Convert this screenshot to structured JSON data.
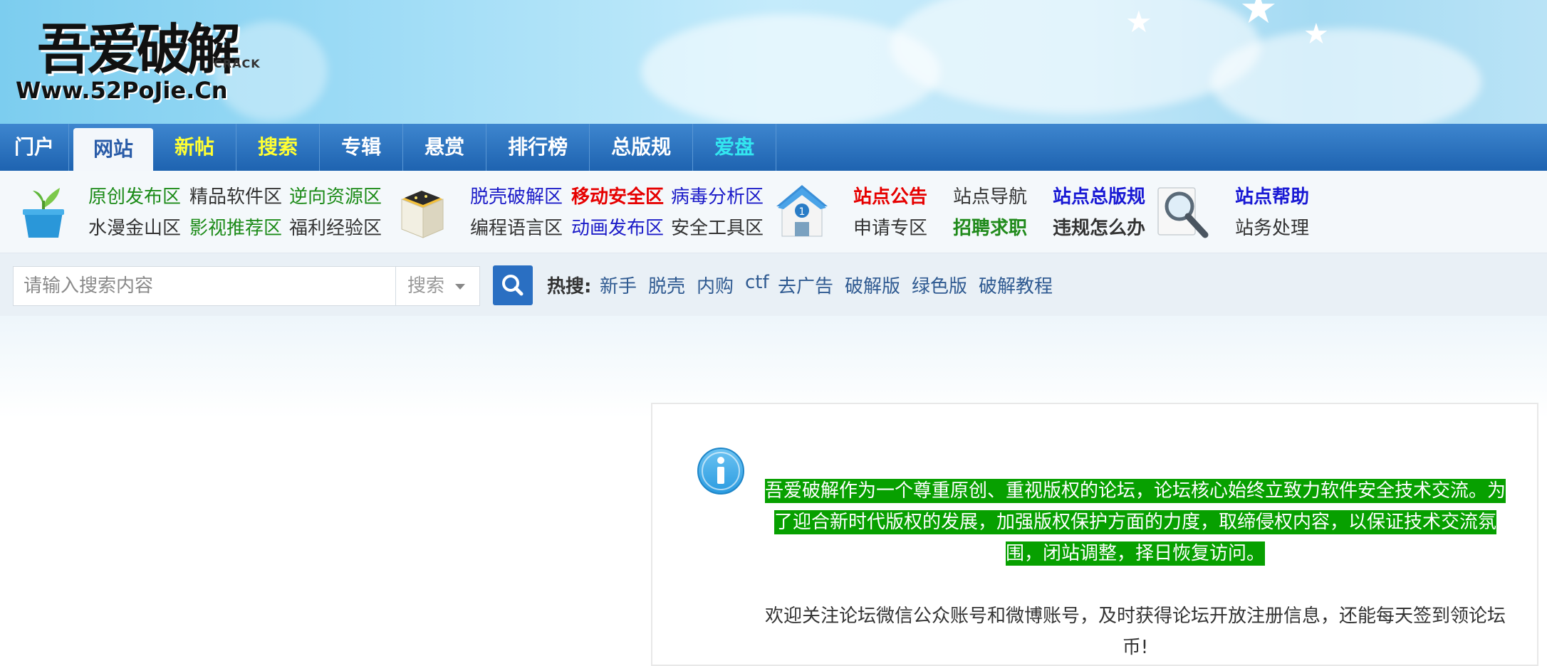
{
  "header": {
    "logo_cn": "吾爱破解",
    "logo_crack": "CRACK",
    "logo_url": "Www.52PoJie.Cn"
  },
  "nav": {
    "items": [
      {
        "label": "门户",
        "color": "#ffffff"
      },
      {
        "label": "网站",
        "color": "#2a5ca8",
        "active": true
      },
      {
        "label": "新帖",
        "color": "#ffff33"
      },
      {
        "label": "搜索",
        "color": "#ffff33"
      },
      {
        "label": "专辑",
        "color": "#ffffff"
      },
      {
        "label": "悬赏",
        "color": "#ffffff"
      },
      {
        "label": "排行榜",
        "color": "#ffffff"
      },
      {
        "label": "总版规",
        "color": "#ffffff"
      },
      {
        "label": "爱盘",
        "color": "#33e6f0"
      }
    ]
  },
  "categories": {
    "group1": [
      "原创发布区",
      "精品软件区",
      "逆向资源区",
      "水漫金山区",
      "影视推荐区",
      "福利经验区"
    ],
    "group2": [
      "脱壳破解区",
      "移动安全区",
      "病毒分析区",
      "编程语言区",
      "动画发布区",
      "安全工具区"
    ],
    "group3": [
      "站点公告",
      "站点导航",
      "站点总版规",
      "申请专区",
      "招聘求职",
      "违规怎么办"
    ],
    "group4": [
      "站点帮助",
      "站务处理"
    ]
  },
  "search": {
    "placeholder": "请输入搜索内容",
    "type_label": "搜索",
    "hot_label": "热搜:",
    "hot_terms": [
      "新手",
      "脱壳",
      "内购",
      "ctf",
      "去广告",
      "破解版",
      "绿色版",
      "破解教程"
    ]
  },
  "notice": {
    "highlight_lines": [
      "吾爱破解作为一个尊重原创、重视版权的论坛，论坛核心始终立致力软件安全技术交流。为",
      "了迎合新时代版权的发展，加强版权保护方面的力度，取缔侵权内容，以保证技术交流氛",
      "围，闭站调整，择日恢复访问。"
    ],
    "welcome_text": "欢迎关注论坛微信公众账号和微博账号，及时获得论坛开放注册信息，还能每天签到领论坛币!"
  },
  "icons": [
    "sprout-icon",
    "box-icon",
    "house-icon",
    "magnifier-icon",
    "search-icon",
    "info-icon"
  ]
}
